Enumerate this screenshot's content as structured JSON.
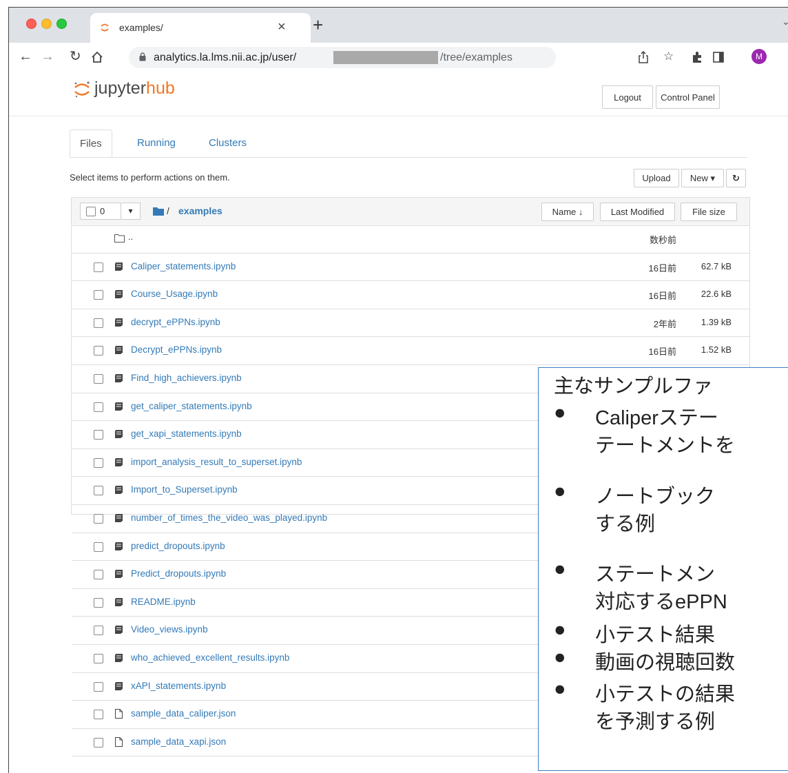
{
  "browser": {
    "tab_title": "examples/",
    "tab_close": "×",
    "new_tab": "+",
    "tab_menu": "⌄",
    "url_host": "analytics.la.lms.nii.ac.jp/user/",
    "url_path": "/tree/examples",
    "profile_initial": "M"
  },
  "header": {
    "logo_prefix": "jupyter",
    "logo_suffix": "hub",
    "logout": "Logout",
    "control_panel": "Control Panel"
  },
  "tabs": [
    "Files",
    "Running",
    "Clusters"
  ],
  "toolbar": {
    "hint": "Select items to perform actions on them.",
    "upload": "Upload",
    "new": "New ▾",
    "refresh": "↻"
  },
  "listing": {
    "selected_count": "0",
    "dropdown": "▾",
    "breadcrumb_sep": "/",
    "breadcrumb_folder": "examples",
    "col_name": "Name ↓",
    "col_modified": "Last Modified",
    "col_size": "File size",
    "parent": {
      "name": "..",
      "modified": "数秒前"
    },
    "rows": [
      {
        "name": "Caliper_statements.ipynb",
        "modified": "16日前",
        "size": "62.7 kB",
        "type": "notebook"
      },
      {
        "name": "Course_Usage.ipynb",
        "modified": "16日前",
        "size": "22.6 kB",
        "type": "notebook"
      },
      {
        "name": "decrypt_ePPNs.ipynb",
        "modified": "2年前",
        "size": "1.39 kB",
        "type": "notebook"
      },
      {
        "name": "Decrypt_ePPNs.ipynb",
        "modified": "16日前",
        "size": "1.52 kB",
        "type": "notebook"
      },
      {
        "name": "Find_high_achievers.ipynb",
        "modified": "",
        "size": "",
        "type": "notebook"
      },
      {
        "name": "get_caliper_statements.ipynb",
        "modified": "",
        "size": "",
        "type": "notebook"
      },
      {
        "name": "get_xapi_statements.ipynb",
        "modified": "",
        "size": "",
        "type": "notebook"
      },
      {
        "name": "import_analysis_result_to_superset.ipynb",
        "modified": "",
        "size": "",
        "type": "notebook"
      },
      {
        "name": "Import_to_Superset.ipynb",
        "modified": "",
        "size": "",
        "type": "notebook"
      },
      {
        "name": "number_of_times_the_video_was_played.ipynb",
        "modified": "",
        "size": "",
        "type": "notebook"
      },
      {
        "name": "predict_dropouts.ipynb",
        "modified": "",
        "size": "",
        "type": "notebook"
      },
      {
        "name": "Predict_dropouts.ipynb",
        "modified": "",
        "size": "",
        "type": "notebook"
      },
      {
        "name": "README.ipynb",
        "modified": "",
        "size": "",
        "type": "notebook"
      },
      {
        "name": "Video_views.ipynb",
        "modified": "",
        "size": "",
        "type": "notebook"
      },
      {
        "name": "who_achieved_excellent_results.ipynb",
        "modified": "",
        "size": "",
        "type": "notebook"
      },
      {
        "name": "xAPI_statements.ipynb",
        "modified": "",
        "size": "",
        "type": "notebook"
      },
      {
        "name": "sample_data_caliper.json",
        "modified": "",
        "size": "",
        "type": "file"
      },
      {
        "name": "sample_data_xapi.json",
        "modified": "",
        "size": "",
        "type": "file"
      }
    ]
  },
  "callout": {
    "title": "主なサンプルファ",
    "bullet_mark": "●",
    "bullets": [
      {
        "line1": "Caliperステー",
        "line2": "テートメントを"
      },
      {
        "line1": "ノートブック",
        "line2": "する例"
      },
      {
        "line1": "ステートメン",
        "line2": "対応するePPN"
      },
      {
        "line1": "小テスト結果",
        "line2": ""
      },
      {
        "line1": "動画の視聴回数",
        "line2": ""
      },
      {
        "line1": "小テストの結果",
        "line2": "を予測する例"
      }
    ]
  },
  "colors": {
    "link": "#337ab7",
    "hub_orange": "#f37726",
    "callout_border": "#3b7fc4"
  }
}
